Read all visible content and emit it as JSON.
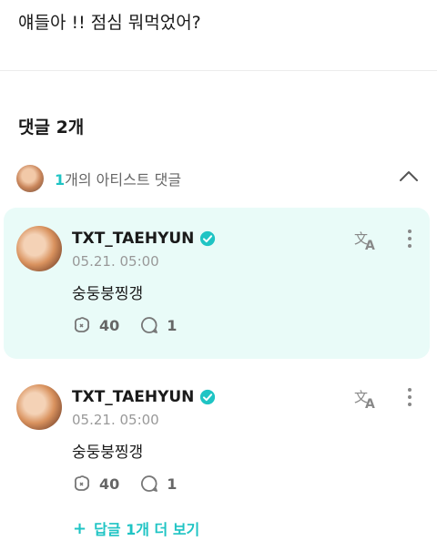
{
  "post": {
    "text": "얘들아 !! 점심 뭐먹었어?"
  },
  "comments_section": {
    "title": "댓글 2개",
    "artist_row": {
      "count": "1",
      "label": "개의 아티스트 댓글"
    }
  },
  "comments": [
    {
      "author": "TXT_TAEHYUN",
      "date": "05.21. 05:00",
      "text": "숭둥붕찡갱",
      "likes": "40",
      "replies": "1",
      "highlighted": true
    },
    {
      "author": "TXT_TAEHYUN",
      "date": "05.21. 05:00",
      "text": "숭둥붕찡갱",
      "likes": "40",
      "replies": "1",
      "highlighted": false
    }
  ],
  "more_replies": {
    "plus": "+",
    "label": "답글 1개 더 보기"
  },
  "colors": {
    "accent": "#1fc4c4",
    "highlight_bg": "#e9fbf8"
  }
}
